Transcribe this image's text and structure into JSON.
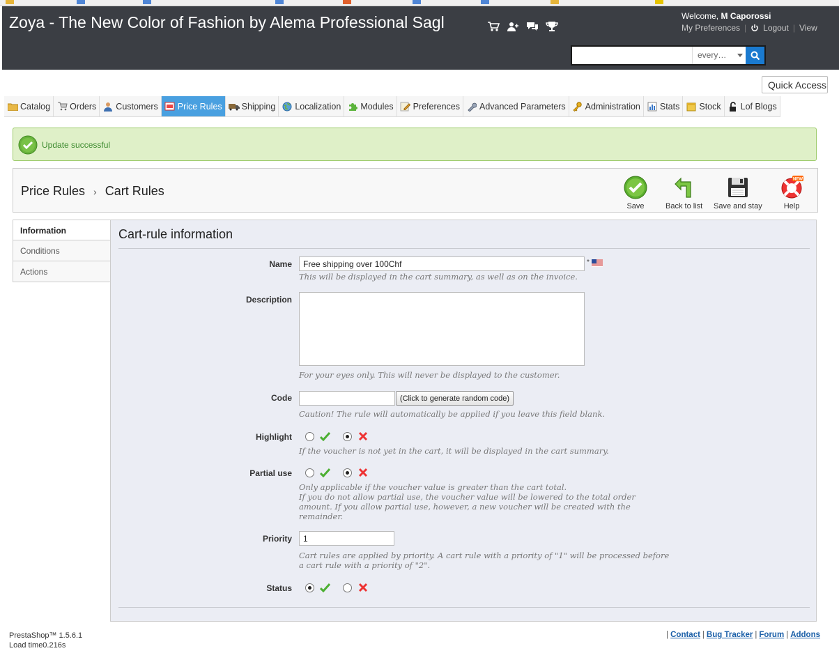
{
  "header": {
    "shop_title": "Zoya - The New Color of Fashion by Alema Professional Sagl",
    "welcome_prefix": "Welcome,",
    "user_name": "M Caporossi",
    "my_preferences": "My Preferences",
    "logout": "Logout",
    "view": "View",
    "search_placeholder": "",
    "search_scope": "every…"
  },
  "quick_access": "Quick Access",
  "menu": [
    {
      "label": "Catalog",
      "icon": "folder-icon"
    },
    {
      "label": "Orders",
      "icon": "cart-icon"
    },
    {
      "label": "Customers",
      "icon": "person-icon"
    },
    {
      "label": "Price Rules",
      "icon": "price-tag-icon"
    },
    {
      "label": "Shipping",
      "icon": "truck-icon"
    },
    {
      "label": "Localization",
      "icon": "globe-icon"
    },
    {
      "label": "Modules",
      "icon": "puzzle-icon"
    },
    {
      "label": "Preferences",
      "icon": "pencil-icon"
    },
    {
      "label": "Advanced Parameters",
      "icon": "wrench-icon"
    },
    {
      "label": "Administration",
      "icon": "key-icon"
    },
    {
      "label": "Stats",
      "icon": "bar-chart-icon"
    },
    {
      "label": "Stock",
      "icon": "box-icon"
    },
    {
      "label": "Lof Blogs",
      "icon": "lock-icon"
    }
  ],
  "success_message": "Update successful",
  "breadcrumb": {
    "parent": "Price Rules",
    "current": "Cart Rules"
  },
  "toolbar": {
    "save": "Save",
    "back_to_list": "Back to list",
    "save_and_stay": "Save and stay",
    "help": "Help",
    "help_badge": "NEW"
  },
  "side_tabs": [
    "Information",
    "Conditions",
    "Actions"
  ],
  "form": {
    "title": "Cart-rule information",
    "name_label": "Name",
    "name_value": "Free shipping over 100Chf",
    "name_required": "*",
    "name_hint": "This will be displayed in the cart summary, as well as on the invoice.",
    "description_label": "Description",
    "description_value": "",
    "description_hint": "For your eyes only. This will never be displayed to the customer.",
    "code_label": "Code",
    "code_value": "",
    "code_button": "(Click to generate random code)",
    "code_hint": "Caution! The rule will automatically be applied if you leave this field blank.",
    "highlight_label": "Highlight",
    "highlight_hint": "If the voucher is not yet in the cart, it will be displayed in the cart summary.",
    "partial_label": "Partial use",
    "partial_hint_1": "Only applicable if the voucher value is greater than the cart total.",
    "partial_hint_2": "If you do not allow partial use, the voucher value will be lowered to the total order",
    "partial_hint_3": "amount. If you allow partial use, however, a new voucher will be created with the",
    "partial_hint_4": "remainder.",
    "priority_label": "Priority",
    "priority_value": "1",
    "priority_hint_1": "Cart rules are applied by priority. A cart rule with a priority of \"1\" will be processed before",
    "priority_hint_2": "a cart rule with a priority of \"2\".",
    "status_label": "Status"
  },
  "footer": {
    "version": "PrestaShop™ 1.5.6.1",
    "load_time": "Load time0.216s",
    "separator": "|",
    "links": [
      "Contact",
      "Bug Tracker",
      "Forum",
      "Addons"
    ]
  }
}
